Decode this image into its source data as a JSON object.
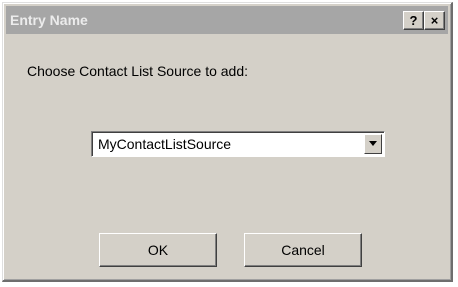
{
  "window": {
    "title": "Entry Name",
    "help_label": "?",
    "close_label": "×"
  },
  "dialog": {
    "prompt": "Choose Contact List Source to add:",
    "source_select": {
      "selected_value": "MyContactListSource"
    },
    "ok_label": "OK",
    "cancel_label": "Cancel"
  },
  "colors": {
    "dialog_background": "#d4d0c8",
    "titlebar_inactive": "#a6a6a6"
  }
}
